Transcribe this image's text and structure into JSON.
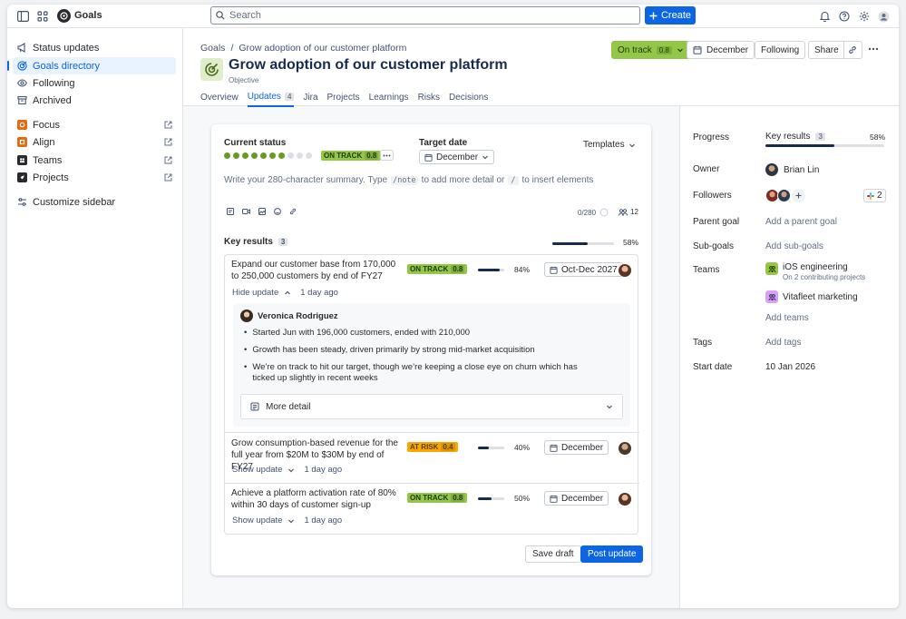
{
  "app": {
    "name": "Goals"
  },
  "search": {
    "placeholder": "Search"
  },
  "create_label": "Create",
  "sidebar": {
    "items": [
      {
        "label": "Status updates",
        "icon": "megaphone-icon"
      },
      {
        "label": "Goals directory",
        "icon": "goal-icon",
        "active": true
      },
      {
        "label": "Following",
        "icon": "eye-icon"
      },
      {
        "label": "Archived",
        "icon": "archive-icon"
      }
    ],
    "apps": [
      {
        "label": "Focus",
        "icon": "focus-icon",
        "color": "#e56910"
      },
      {
        "label": "Align",
        "icon": "align-icon",
        "color": "#e56910"
      },
      {
        "label": "Teams",
        "icon": "teams-icon",
        "color": "#292a2e"
      },
      {
        "label": "Projects",
        "icon": "rocket-icon",
        "color": "#292a2e"
      }
    ],
    "customize": "Customize sidebar"
  },
  "breadcrumb": {
    "root": "Goals",
    "separator": "/",
    "current": "Grow adoption of our customer platform"
  },
  "page": {
    "title": "Grow adoption of our customer platform",
    "subtitle": "Objective"
  },
  "tabs": [
    {
      "label": "Overview"
    },
    {
      "label": "Updates",
      "count": "4",
      "active": true
    },
    {
      "label": "Jira"
    },
    {
      "label": "Projects"
    },
    {
      "label": "Learnings"
    },
    {
      "label": "Risks"
    },
    {
      "label": "Decisions"
    }
  ],
  "header_actions": {
    "status": "On track",
    "status_value": "0.8",
    "date": "December",
    "following": "Following",
    "share": "Share"
  },
  "update_card": {
    "current_status_label": "Current status",
    "status_lozenge": "ON TRACK",
    "status_value": "0.8",
    "score_dots_filled": 7,
    "score_dots_total": 10,
    "target_date_label": "Target date",
    "target_date": "December",
    "templates": "Templates",
    "summary_placeholder_a": "Write your 280-character summary. Type",
    "summary_code_a": "/note",
    "summary_placeholder_b": "to add more detail or",
    "summary_code_b": "/",
    "summary_placeholder_c": "to insert elements",
    "char_count": "0/280",
    "watchers": "12",
    "key_results_label": "Key results",
    "key_results_count": "3",
    "key_results_percent": "58%",
    "key_results_progress": 0.58,
    "save_draft": "Save draft",
    "post_update": "Post update"
  },
  "key_results": [
    {
      "title": "Expand our customer base from 170,000 to 250,000 customers by end of FY27",
      "status": "ON TRACK",
      "status_kind": "ok",
      "value": "0.8",
      "percent": "84%",
      "progress": 0.84,
      "date": "Oct-Dec 2027",
      "toggle": "Hide update",
      "ago": "1 day ago",
      "update": {
        "author": "Veronica Rodriguez",
        "bullets": [
          "Started Jun with 196,000 customers, ended with 210,000",
          "Growth has been steady, driven primarily by strong mid-market acquisition",
          "We’re on track to hit our target, though we’re keeping a close eye on churn which has ticked up slightly in recent weeks"
        ],
        "more": "More detail"
      }
    },
    {
      "title": "Grow consumption-based revenue for the full year from $20M to $30M by end of FY27",
      "status": "AT RISK",
      "status_kind": "risk",
      "value": "0.4",
      "percent": "40%",
      "progress": 0.4,
      "date": "December",
      "toggle": "Show update",
      "ago": "1 day ago"
    },
    {
      "title": "Achieve a platform activation rate of 80% within 30 days of customer sign-up",
      "status": "ON TRACK",
      "status_kind": "ok",
      "value": "0.8",
      "percent": "50%",
      "progress": 0.5,
      "date": "December",
      "toggle": "Show update",
      "ago": "1 day ago"
    }
  ],
  "details": {
    "progress_label": "Progress",
    "kr_label": "Key results",
    "kr_count": "3",
    "kr_percent": "58%",
    "kr_progress": 0.58,
    "owner_label": "Owner",
    "owner": "Brian Lin",
    "followers_label": "Followers",
    "followers_slack_count": "2",
    "parent_label": "Parent goal",
    "parent_value": "Add a parent goal",
    "subgoals_label": "Sub-goals",
    "subgoals_value": "Add sub-goals",
    "teams_label": "Teams",
    "teams": [
      {
        "name": "iOS engineering",
        "sub": "On 2 contributing projects",
        "color": "#94c748"
      },
      {
        "name": "Vitafleet marketing",
        "sub": "",
        "color": "#d8a0f7"
      }
    ],
    "add_teams": "Add teams",
    "tags_label": "Tags",
    "tags_value": "Add tags",
    "start_label": "Start date",
    "start_value": "10 Jan 2026"
  }
}
